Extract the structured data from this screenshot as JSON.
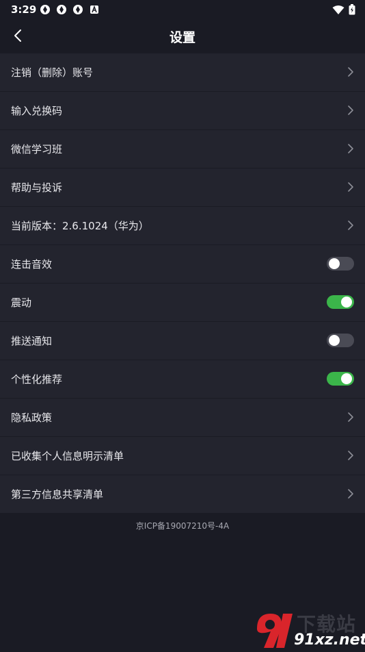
{
  "status_bar": {
    "time": "3:29",
    "icons": [
      "app-notification-icon",
      "app-notification-icon",
      "app-notification-icon",
      "accessibility-a-icon"
    ],
    "right_icons": [
      "wifi-icon",
      "battery-charging-icon"
    ]
  },
  "header": {
    "title": "设置",
    "back_icon": "chevron-left-icon"
  },
  "settings": {
    "items": [
      {
        "label": "注销（删除）账号",
        "type": "link"
      },
      {
        "label": "输入兑换码",
        "type": "link"
      },
      {
        "label": "微信学习班",
        "type": "link"
      },
      {
        "label": "帮助与投诉",
        "type": "link"
      },
      {
        "label": "当前版本：2.6.1024（华为）",
        "type": "link"
      },
      {
        "label": "连击音效",
        "type": "toggle",
        "on": false
      },
      {
        "label": "震动",
        "type": "toggle",
        "on": true
      },
      {
        "label": "推送通知",
        "type": "toggle",
        "on": false
      },
      {
        "label": "个性化推荐",
        "type": "toggle",
        "on": true
      },
      {
        "label": "隐私政策",
        "type": "link"
      },
      {
        "label": "已收集个人信息明示清单",
        "type": "link"
      },
      {
        "label": "第三方信息共享清单",
        "type": "link"
      }
    ]
  },
  "footer": {
    "icp": "京ICP备19007210号-4A"
  },
  "watermark": {
    "top_text": "下载站",
    "bottom_text": "91xz.net"
  },
  "colors": {
    "background": "#1a1b24",
    "row_background": "#23242e",
    "toggle_on": "#3bb54a",
    "toggle_off": "#4a4b55"
  }
}
